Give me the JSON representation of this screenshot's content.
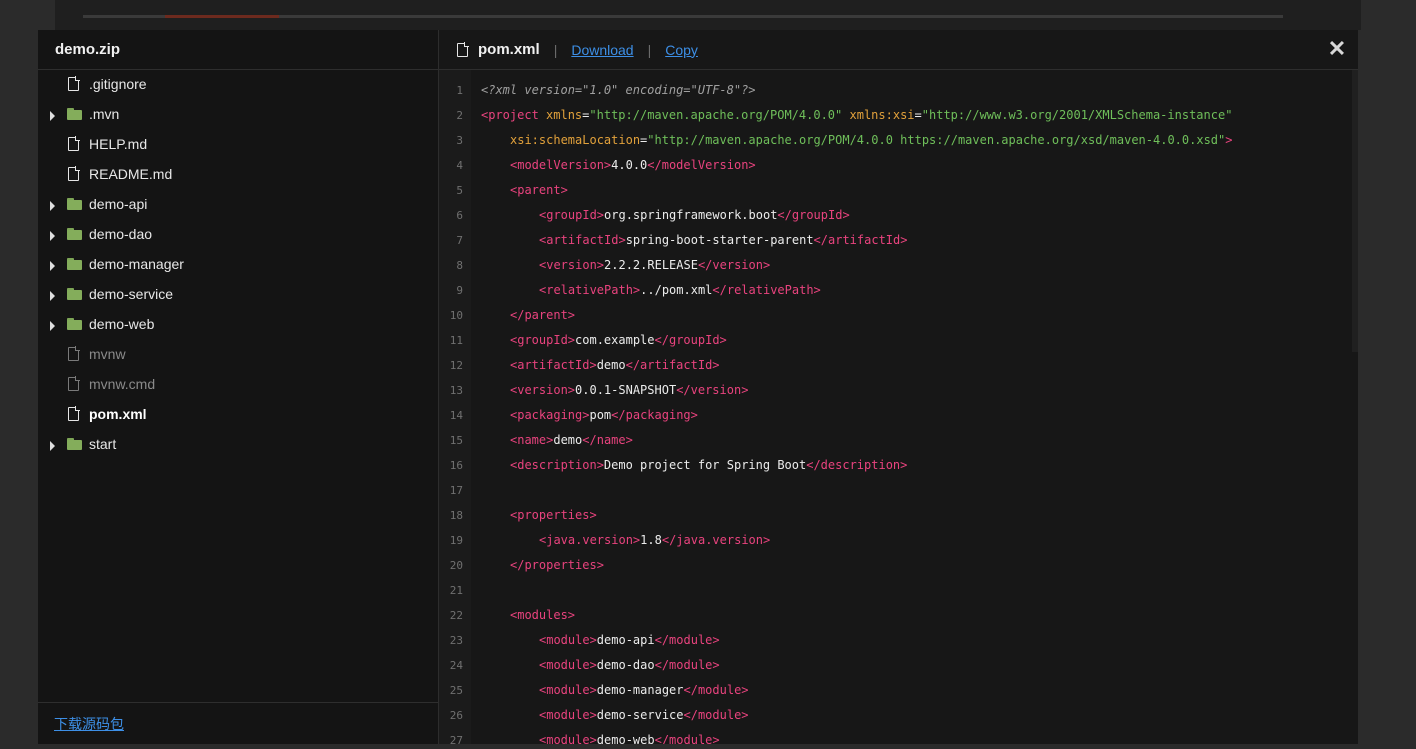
{
  "sidebar": {
    "title": "demo.zip",
    "items": [
      {
        "label": ".gitignore",
        "type": "file"
      },
      {
        "label": ".mvn",
        "type": "folder"
      },
      {
        "label": "HELP.md",
        "type": "file"
      },
      {
        "label": "README.md",
        "type": "file"
      },
      {
        "label": "demo-api",
        "type": "folder"
      },
      {
        "label": "demo-dao",
        "type": "folder"
      },
      {
        "label": "demo-manager",
        "type": "folder"
      },
      {
        "label": "demo-service",
        "type": "folder"
      },
      {
        "label": "demo-web",
        "type": "folder"
      },
      {
        "label": "mvnw",
        "type": "file-dim"
      },
      {
        "label": "mvnw.cmd",
        "type": "file-dim"
      },
      {
        "label": "pom.xml",
        "type": "file-active"
      },
      {
        "label": "start",
        "type": "folder"
      }
    ],
    "footer_link": "下载源码包"
  },
  "header": {
    "filename": "pom.xml",
    "separator": "|",
    "download_label": "Download",
    "copy_label": "Copy",
    "close_glyph": "✕"
  },
  "code": {
    "lines": [
      {
        "n": "1",
        "indent": 0,
        "parts": [
          [
            "decl",
            "<?xml version=\"1.0\" encoding=\"UTF-8\"?>"
          ]
        ]
      },
      {
        "n": "2",
        "indent": 0,
        "parts": [
          [
            "tag",
            "<project "
          ],
          [
            "attr",
            "xmlns"
          ],
          [
            "plain",
            "="
          ],
          [
            "val",
            "\"http://maven.apache.org/POM/4.0.0\""
          ],
          [
            "plain",
            " "
          ],
          [
            "attr",
            "xmlns:xsi"
          ],
          [
            "plain",
            "="
          ],
          [
            "val",
            "\"http://www.w3.org/2001/XMLSchema-instance\""
          ]
        ]
      },
      {
        "n": "3",
        "indent": 1,
        "parts": [
          [
            "attr",
            "xsi:schemaLocation"
          ],
          [
            "plain",
            "="
          ],
          [
            "val",
            "\"http://maven.apache.org/POM/4.0.0 https://maven.apache.org/xsd/maven-4.0.0.xsd\""
          ],
          [
            "tag",
            ">"
          ]
        ]
      },
      {
        "n": "4",
        "indent": 1,
        "parts": [
          [
            "tag",
            "<modelVersion>"
          ],
          [
            "plain",
            "4.0.0"
          ],
          [
            "tag",
            "</modelVersion>"
          ]
        ]
      },
      {
        "n": "5",
        "indent": 1,
        "parts": [
          [
            "tag",
            "<parent>"
          ]
        ]
      },
      {
        "n": "6",
        "indent": 2,
        "parts": [
          [
            "tag",
            "<groupId>"
          ],
          [
            "plain",
            "org.springframework.boot"
          ],
          [
            "tag",
            "</groupId>"
          ]
        ]
      },
      {
        "n": "7",
        "indent": 2,
        "parts": [
          [
            "tag",
            "<artifactId>"
          ],
          [
            "plain",
            "spring-boot-starter-parent"
          ],
          [
            "tag",
            "</artifactId>"
          ]
        ]
      },
      {
        "n": "8",
        "indent": 2,
        "parts": [
          [
            "tag",
            "<version>"
          ],
          [
            "plain",
            "2.2.2.RELEASE"
          ],
          [
            "tag",
            "</version>"
          ]
        ]
      },
      {
        "n": "9",
        "indent": 2,
        "parts": [
          [
            "tag",
            "<relativePath>"
          ],
          [
            "plain",
            "../pom.xml"
          ],
          [
            "tag",
            "</relativePath>"
          ]
        ]
      },
      {
        "n": "10",
        "indent": 1,
        "parts": [
          [
            "tag",
            "</parent>"
          ]
        ]
      },
      {
        "n": "11",
        "indent": 1,
        "parts": [
          [
            "tag",
            "<groupId>"
          ],
          [
            "plain",
            "com.example"
          ],
          [
            "tag",
            "</groupId>"
          ]
        ]
      },
      {
        "n": "12",
        "indent": 1,
        "parts": [
          [
            "tag",
            "<artifactId>"
          ],
          [
            "plain",
            "demo"
          ],
          [
            "tag",
            "</artifactId>"
          ]
        ]
      },
      {
        "n": "13",
        "indent": 1,
        "parts": [
          [
            "tag",
            "<version>"
          ],
          [
            "plain",
            "0.0.1-SNAPSHOT"
          ],
          [
            "tag",
            "</version>"
          ]
        ]
      },
      {
        "n": "14",
        "indent": 1,
        "parts": [
          [
            "tag",
            "<packaging>"
          ],
          [
            "plain",
            "pom"
          ],
          [
            "tag",
            "</packaging>"
          ]
        ]
      },
      {
        "n": "15",
        "indent": 1,
        "parts": [
          [
            "tag",
            "<name>"
          ],
          [
            "plain",
            "demo"
          ],
          [
            "tag",
            "</name>"
          ]
        ]
      },
      {
        "n": "16",
        "indent": 1,
        "parts": [
          [
            "tag",
            "<description>"
          ],
          [
            "plain",
            "Demo project for Spring Boot"
          ],
          [
            "tag",
            "</description>"
          ]
        ]
      },
      {
        "n": "17",
        "indent": 0,
        "parts": []
      },
      {
        "n": "18",
        "indent": 1,
        "parts": [
          [
            "tag",
            "<properties>"
          ]
        ]
      },
      {
        "n": "19",
        "indent": 2,
        "parts": [
          [
            "tag",
            "<java.version>"
          ],
          [
            "plain",
            "1.8"
          ],
          [
            "tag",
            "</java.version>"
          ]
        ]
      },
      {
        "n": "20",
        "indent": 1,
        "parts": [
          [
            "tag",
            "</properties>"
          ]
        ]
      },
      {
        "n": "21",
        "indent": 0,
        "parts": []
      },
      {
        "n": "22",
        "indent": 1,
        "parts": [
          [
            "tag",
            "<modules>"
          ]
        ]
      },
      {
        "n": "23",
        "indent": 2,
        "parts": [
          [
            "tag",
            "<module>"
          ],
          [
            "plain",
            "demo-api"
          ],
          [
            "tag",
            "</module>"
          ]
        ]
      },
      {
        "n": "24",
        "indent": 2,
        "parts": [
          [
            "tag",
            "<module>"
          ],
          [
            "plain",
            "demo-dao"
          ],
          [
            "tag",
            "</module>"
          ]
        ]
      },
      {
        "n": "25",
        "indent": 2,
        "parts": [
          [
            "tag",
            "<module>"
          ],
          [
            "plain",
            "demo-manager"
          ],
          [
            "tag",
            "</module>"
          ]
        ]
      },
      {
        "n": "26",
        "indent": 2,
        "parts": [
          [
            "tag",
            "<module>"
          ],
          [
            "plain",
            "demo-service"
          ],
          [
            "tag",
            "</module>"
          ]
        ]
      },
      {
        "n": "27",
        "indent": 2,
        "parts": [
          [
            "tag",
            "<module>"
          ],
          [
            "plain",
            "demo-web"
          ],
          [
            "tag",
            "</module>"
          ]
        ]
      }
    ]
  },
  "colors": {
    "tag": "#e9437e",
    "attr": "#e2a13b",
    "value": "#6fbf5a",
    "link": "#3d8fe6",
    "folder": "#84ad5b"
  }
}
